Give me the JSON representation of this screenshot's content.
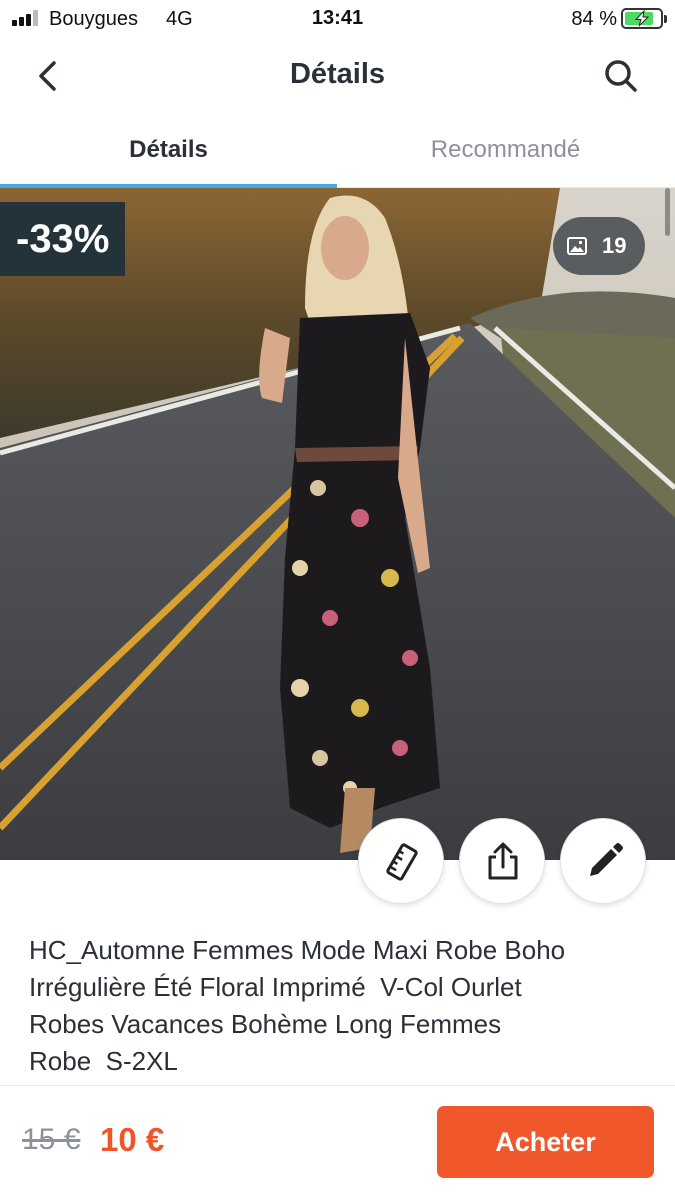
{
  "status_bar": {
    "carrier": "Bouygues",
    "network": "4G",
    "time": "13:41",
    "battery_percent": "84 %",
    "battery_level": 0.84
  },
  "nav": {
    "title": "Détails",
    "back_icon": "chevron-left-icon",
    "search_icon": "search-icon"
  },
  "tabs": [
    {
      "label": "Détails",
      "active": true
    },
    {
      "label": "Recommandé",
      "active": false
    }
  ],
  "gallery": {
    "discount": "-33%",
    "photo_count": "19",
    "photo_icon": "image-icon"
  },
  "actions": [
    {
      "name": "size-guide",
      "icon": "ruler-icon"
    },
    {
      "name": "share",
      "icon": "share-icon"
    },
    {
      "name": "edit",
      "icon": "pencil-icon"
    }
  ],
  "product": {
    "title_lines": [
      "HC_Automne Femmes Mode Maxi Robe Boho",
      "Irrégulière Été Floral Imprimé  V-Col Ourlet",
      "Robes Vacances Bohème Long Femmes",
      "Robe  S-2XL"
    ]
  },
  "purchase": {
    "old_price": "15 €",
    "new_price": "10 €",
    "buy_label": "Acheter"
  },
  "colors": {
    "accent_orange": "#f0582b",
    "tab_indicator": "#4aa6e0",
    "badge_dark": "#243239",
    "text_dark": "#2b2f38",
    "text_muted": "#8c919c"
  }
}
